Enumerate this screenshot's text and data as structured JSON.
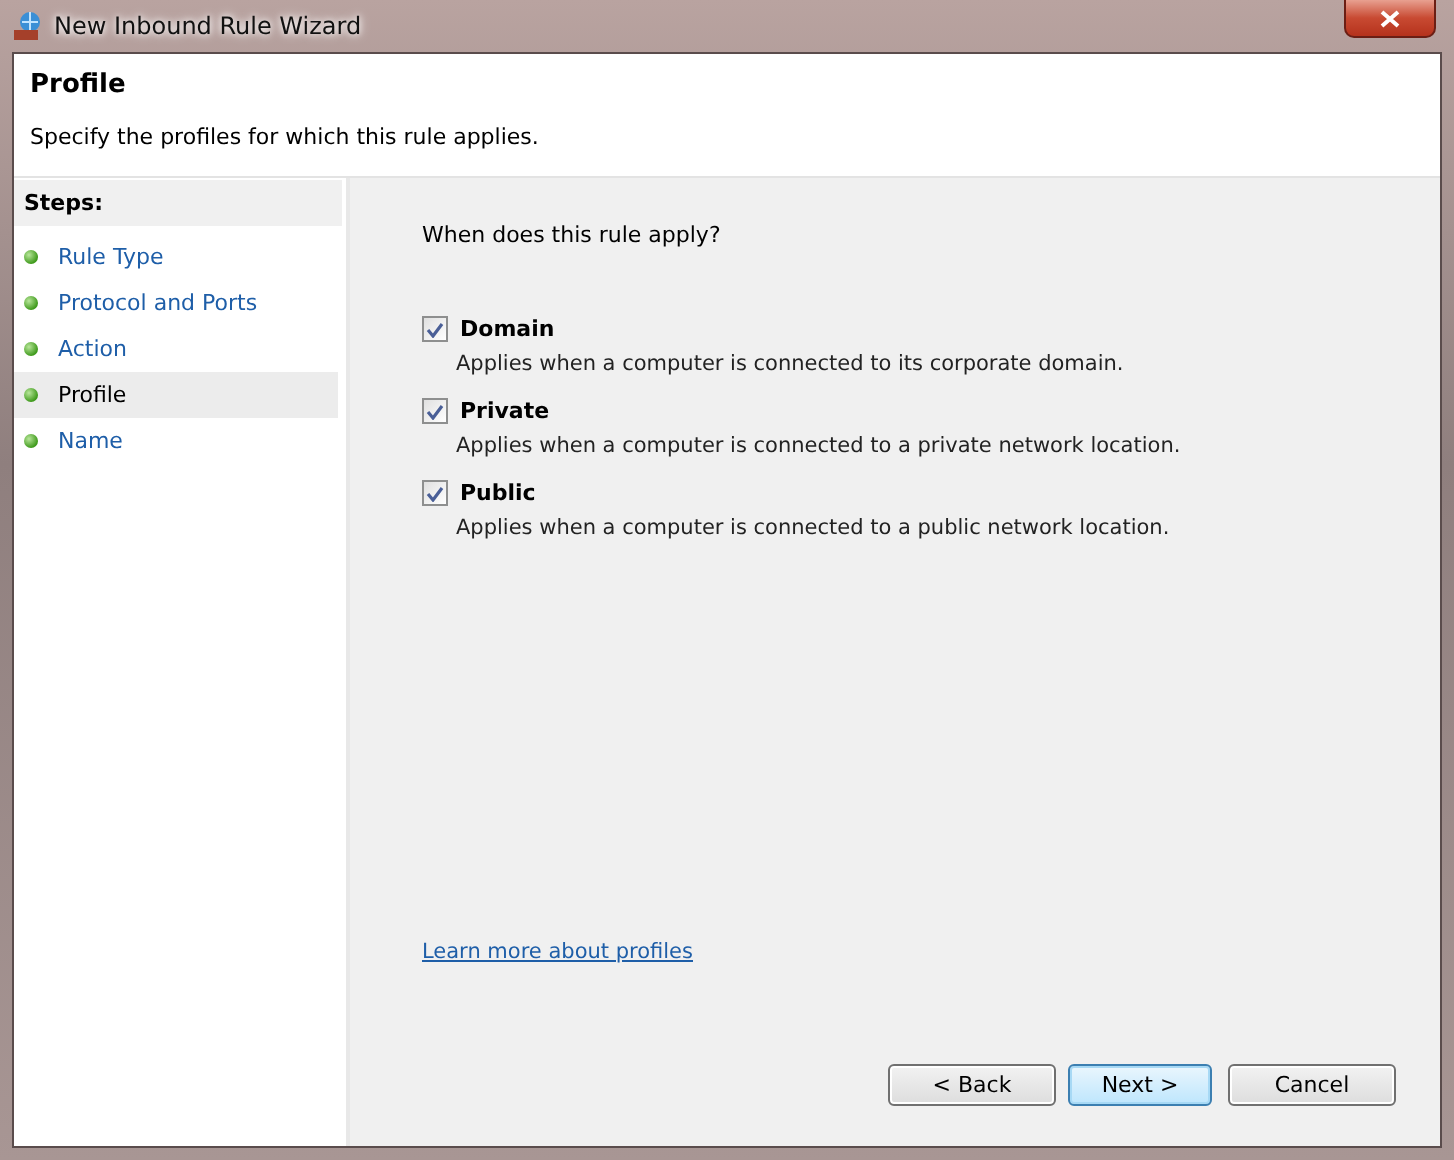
{
  "window": {
    "title": "New Inbound Rule Wizard"
  },
  "header": {
    "title": "Profile",
    "subtitle": "Specify the profiles for which this rule applies."
  },
  "steps": {
    "title": "Steps:",
    "items": [
      {
        "label": "Rule Type",
        "selected": false
      },
      {
        "label": "Protocol and Ports",
        "selected": false
      },
      {
        "label": "Action",
        "selected": false
      },
      {
        "label": "Profile",
        "selected": true
      },
      {
        "label": "Name",
        "selected": false
      }
    ]
  },
  "question": "When does this rule apply?",
  "options": [
    {
      "label": "Domain",
      "description": "Applies when a computer is connected to its corporate domain.",
      "checked": true
    },
    {
      "label": "Private",
      "description": "Applies when a computer is connected to a private network location.",
      "checked": true
    },
    {
      "label": "Public",
      "description": "Applies when a computer is connected to a public network location.",
      "checked": true
    }
  ],
  "link": "Learn more about profiles",
  "buttons": [
    {
      "label": "< Back",
      "kind": "normal"
    },
    {
      "label": "Next >",
      "kind": "default"
    },
    {
      "label": "Cancel",
      "kind": "normal"
    }
  ]
}
